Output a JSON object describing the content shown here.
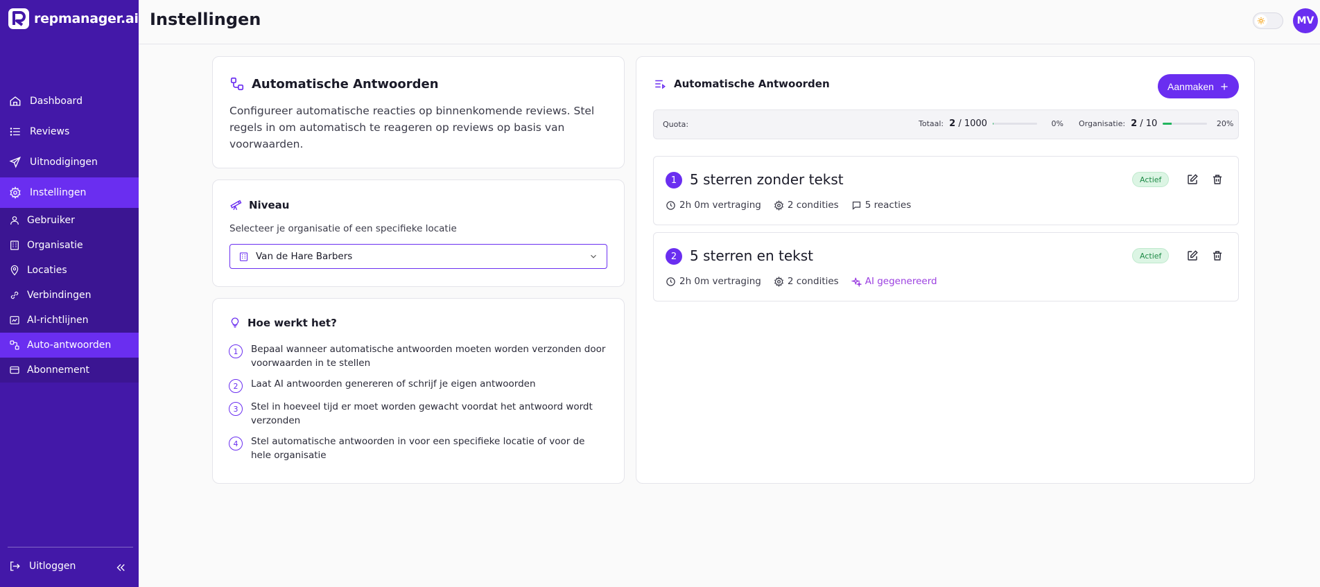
{
  "app": {
    "brand": "repmanager.ai",
    "user_initials": "MV",
    "page_title": "Instellingen"
  },
  "colors": {
    "sidebar": "#4318a8",
    "accent": "#6a2ef0",
    "active_badge": "#1f8a47",
    "ai_text": "#9b3fe0"
  },
  "sidebar": {
    "items": [
      {
        "label": "Dashboard",
        "icon": "home-icon"
      },
      {
        "label": "Reviews",
        "icon": "list-icon"
      },
      {
        "label": "Uitnodigingen",
        "icon": "send-icon"
      },
      {
        "label": "Instellingen",
        "icon": "gear-icon",
        "active": true
      }
    ],
    "subitems": [
      {
        "label": "Gebruiker",
        "icon": "user-icon"
      },
      {
        "label": "Organisatie",
        "icon": "building-icon"
      },
      {
        "label": "Locaties",
        "icon": "map-pin-icon"
      },
      {
        "label": "Verbindingen",
        "icon": "link-icon"
      },
      {
        "label": "AI-richtlijnen",
        "icon": "ai-icon"
      },
      {
        "label": "Auto-antwoorden",
        "icon": "auto-reply-icon",
        "active": true
      },
      {
        "label": "Abonnement",
        "icon": "credit-card-icon"
      }
    ],
    "logout_label": "Uitloggen"
  },
  "intro": {
    "title": "Automatische Antwoorden",
    "description": "Configureer automatische reacties op binnenkomende reviews. Stel regels in om automatisch te reageren op reviews op basis van voorwaarden."
  },
  "niveau": {
    "title": "Niveau",
    "subtitle": "Selecteer je organisatie of een specifieke locatie",
    "selected": "Van de Hare Barbers"
  },
  "how": {
    "title": "Hoe werkt het?",
    "steps": [
      {
        "num": "1",
        "text": "Bepaal wanneer automatische antwoorden moeten worden verzonden door voorwaarden in te stellen"
      },
      {
        "num": "2",
        "text": "Laat AI antwoorden genereren of schrijf je eigen antwoorden"
      },
      {
        "num": "3",
        "text": "Stel in hoeveel tijd er moet worden gewacht voordat het antwoord wordt verzonden"
      },
      {
        "num": "4",
        "text": "Stel automatische antwoorden in voor een specifieke locatie of voor de hele organisatie"
      }
    ]
  },
  "rules_panel": {
    "title": "Automatische Antwoorden",
    "create_label": "Aanmaken",
    "quota": {
      "label": "Quota:",
      "total_label": "Totaal:",
      "total_used": "2",
      "total_sep": "/",
      "total_max": "1000",
      "total_pct": "0%",
      "total_fraction": 0.002,
      "org_label": "Organisatie:",
      "org_used": "2",
      "org_sep": "/",
      "org_max": "10",
      "org_pct": "20%",
      "org_fraction": 0.2
    },
    "rules": [
      {
        "num": "1",
        "title": "5 sterren zonder tekst",
        "status": "Actief",
        "delay": "2h 0m vertraging",
        "conditions": "2 condities",
        "reply": "5 reacties",
        "reply_type": "template"
      },
      {
        "num": "2",
        "title": "5 sterren en tekst",
        "status": "Actief",
        "delay": "2h 0m vertraging",
        "conditions": "2 condities",
        "reply": "AI gegenereerd",
        "reply_type": "ai"
      }
    ]
  }
}
